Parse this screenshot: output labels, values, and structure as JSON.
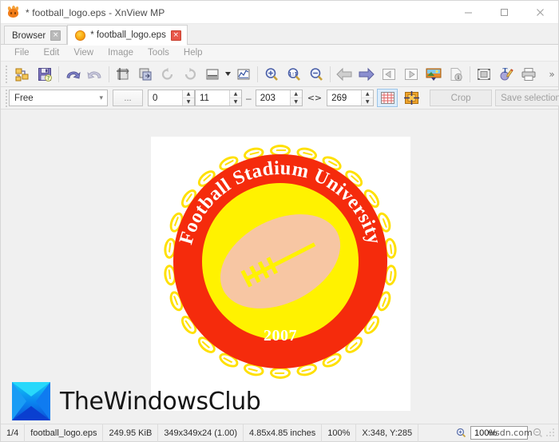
{
  "window": {
    "title": "* football_logo.eps - XnView MP",
    "app_icon": "xnview-flame-icon",
    "minimize_label": "Minimize",
    "maximize_label": "Maximize",
    "close_label": "Close"
  },
  "tabs": [
    {
      "label": "Browser",
      "icon": "none",
      "close_label": "×",
      "active": false
    },
    {
      "label": "* football_logo.eps",
      "icon": "image-tab-icon",
      "close_label": "×",
      "active": true
    }
  ],
  "menu": {
    "items": [
      "File",
      "Edit",
      "View",
      "Image",
      "Tools",
      "Help"
    ]
  },
  "toolbar": {
    "overflow_label": "»",
    "groups": [
      {
        "buttons": [
          {
            "name": "batch-convert-icon",
            "tip": "Batch Convert"
          },
          {
            "name": "save-icon",
            "tip": "Save"
          }
        ]
      },
      {
        "buttons": [
          {
            "name": "undo-icon",
            "tip": "Undo"
          },
          {
            "name": "redo-icon",
            "tip": "Redo"
          }
        ]
      },
      {
        "buttons": [
          {
            "name": "crop-icon",
            "tip": "Crop"
          },
          {
            "name": "resize-icon",
            "tip": "Resize"
          },
          {
            "name": "rotate-left-icon",
            "tip": "Rotate Left"
          },
          {
            "name": "rotate-right-icon",
            "tip": "Rotate Right"
          },
          {
            "name": "adjust-icon",
            "tip": "Adjust"
          },
          {
            "name": "curves-icon",
            "tip": "Curves"
          }
        ]
      },
      {
        "buttons": [
          {
            "name": "zoom-in-icon",
            "tip": "Zoom In"
          },
          {
            "name": "zoom-actual-icon",
            "tip": "Actual Size 1:1"
          },
          {
            "name": "zoom-out-icon",
            "tip": "Zoom Out"
          }
        ]
      },
      {
        "buttons": [
          {
            "name": "previous-image-icon",
            "tip": "Previous"
          },
          {
            "name": "next-image-icon",
            "tip": "Next"
          },
          {
            "name": "first-image-icon",
            "tip": "First"
          },
          {
            "name": "last-image-icon",
            "tip": "Last"
          },
          {
            "name": "slideshow-icon",
            "tip": "Slideshow"
          },
          {
            "name": "info-icon",
            "tip": "Information"
          }
        ]
      },
      {
        "buttons": [
          {
            "name": "fullscreen-icon",
            "tip": "Full Screen"
          },
          {
            "name": "annotate-icon",
            "tip": "Draw / Text"
          },
          {
            "name": "print-icon",
            "tip": "Print"
          }
        ]
      }
    ]
  },
  "selection_bar": {
    "ratio_value": "Free",
    "ratio_chevron": "⌄",
    "more_label": "...",
    "x_value": "0",
    "y_value": "11",
    "dash": "–",
    "width_value": "203",
    "swap_label": "<>",
    "height_value": "269",
    "grid_icon": "selection-grid-icon",
    "lasso_icon": "selection-mask-icon",
    "crop_label": "Crop",
    "save_selection_label": "Save selection as...",
    "overflow_label": "»"
  },
  "canvas": {
    "emblem": {
      "arc_text": "Football Stadium University",
      "year_text": "2007",
      "colors": {
        "ring_red": "#f52b0c",
        "inner_yellow": "#fff200",
        "chain_yellow": "#ffe000",
        "football_tan": "#f7c6a3",
        "text_white": "#ffffff"
      }
    },
    "watermark": {
      "brand": "TheWindowsClub",
      "mark": "thewindowsclub-logo-icon"
    },
    "background_color": "#f0f0f0",
    "sheet_color": "#ffffff"
  },
  "statusbar": {
    "index": "1/4",
    "filename": "football_logo.eps",
    "filesize": "249.95 KiB",
    "dimensions": "349x349x24 (1.00)",
    "print_size": "4.85x4.85 inches",
    "zoom_percent": "100%",
    "cursor_pos": "X:348, Y:285",
    "zoom_field": "100%",
    "zoom_in_icon": "zoom-in-icon",
    "zoom_out_icon": "zoom-out-icon",
    "watermark_text": "wsdn.com"
  }
}
